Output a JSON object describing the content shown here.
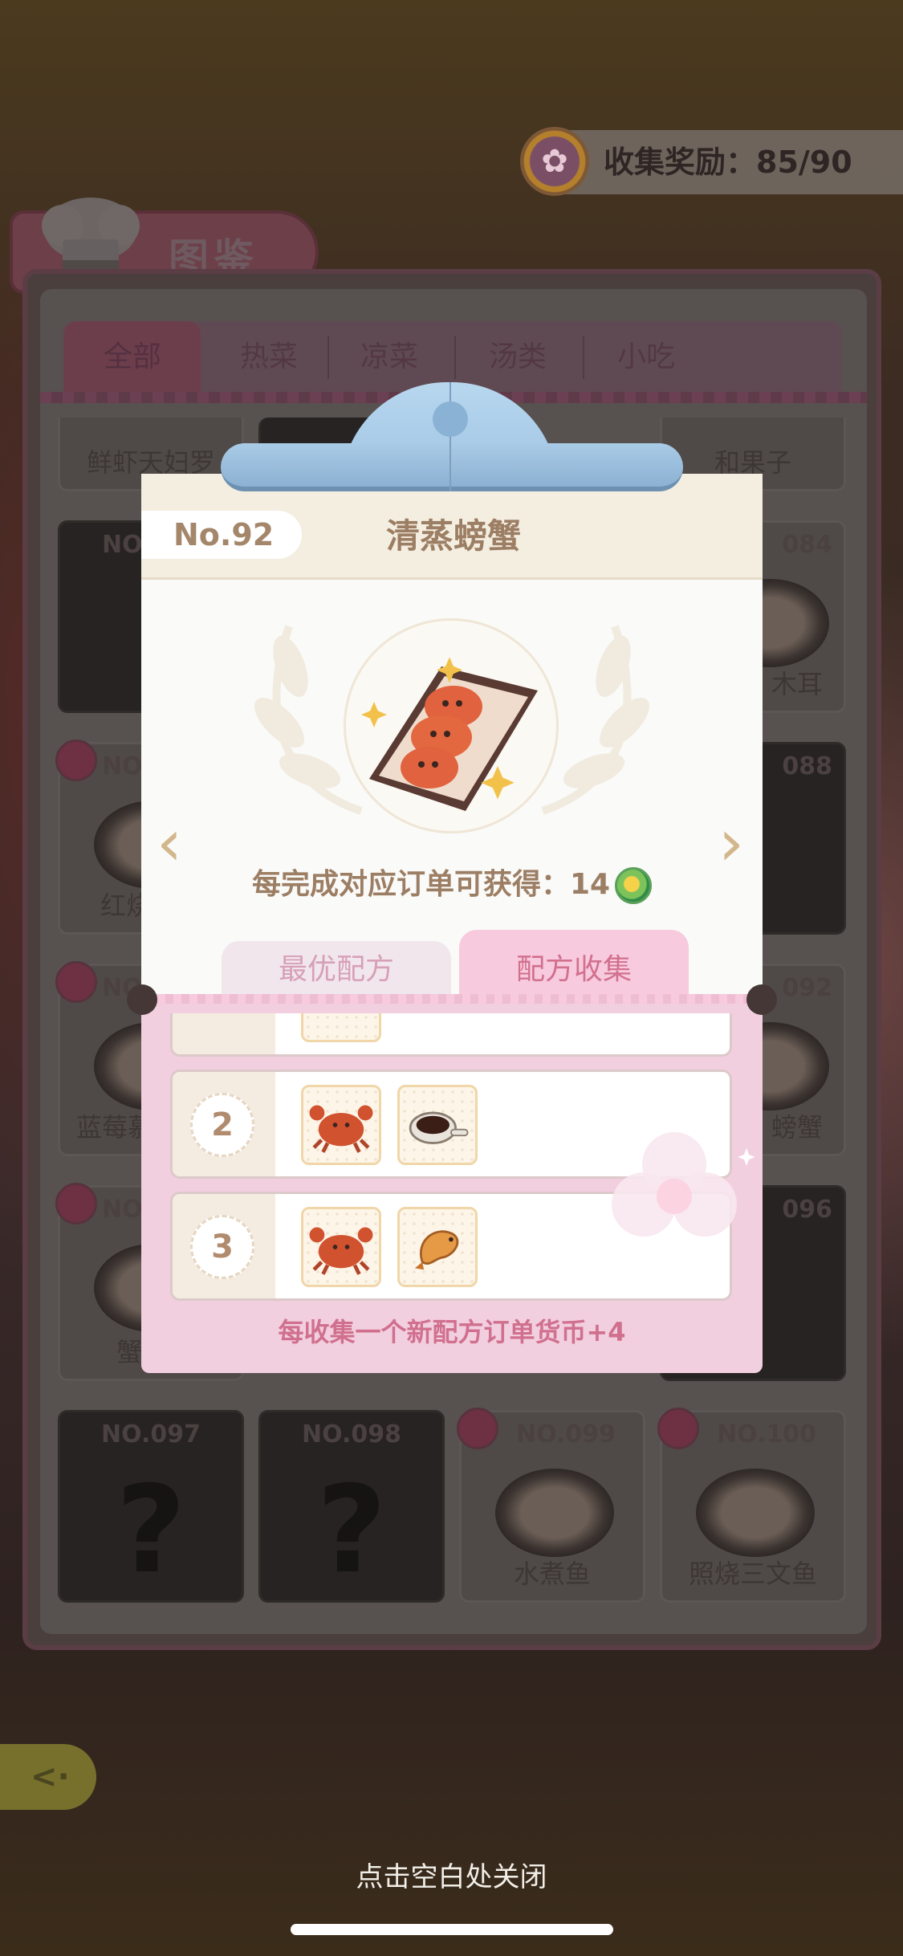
{
  "header": {
    "collect_reward_label": "收集奖励：85/90",
    "title": "图鉴"
  },
  "tabs": [
    "全部",
    "热菜",
    "凉菜",
    "汤类",
    "小吃"
  ],
  "background_grid": {
    "row1_names": [
      "鲜虾天妇罗",
      "和果子"
    ],
    "row2": [
      {
        "no": "NO.",
        "name": ""
      },
      {
        "no": "084",
        "name": "木耳"
      }
    ],
    "row3": [
      {
        "no": "NO.",
        "name": "红烧"
      },
      {
        "no": "088",
        "name": ""
      }
    ],
    "row4": [
      {
        "no": "NO.",
        "name": "蓝莓慕"
      },
      {
        "no": "092",
        "name": "螃蟹"
      }
    ],
    "row5": [
      {
        "no": "NO.",
        "name": "蟹"
      },
      {
        "no": "096",
        "name": ""
      }
    ],
    "row6": [
      {
        "no": "NO.097",
        "name": "",
        "locked": true
      },
      {
        "no": "NO.098",
        "name": "",
        "locked": true
      },
      {
        "no": "NO.099",
        "name": "水煮鱼",
        "locked": false
      },
      {
        "no": "NO.100",
        "name": "照烧三文鱼",
        "locked": false
      }
    ],
    "locked_symbol": "?"
  },
  "modal": {
    "number": "No.92",
    "dish_name": "清蒸螃蟹",
    "reward_text": "每完成对应订单可获得：14",
    "prev_arrow": "‹",
    "next_arrow": "›",
    "tab_best": "最优配方",
    "tab_collect": "配方收集",
    "recipes": [
      {
        "num": "2",
        "ingredients": [
          "crab-icon",
          "soy-sauce-icon"
        ]
      },
      {
        "num": "3",
        "ingredients": [
          "crab-icon",
          "shrimp-icon"
        ]
      }
    ],
    "footer_note": "每收集一个新配方订单货币+4"
  },
  "close_hint": "点击空白处关闭",
  "colors": {
    "accent_pink": "#d2708e",
    "clip_blue": "#9ec3e2",
    "header_brown": "#9c7e64"
  }
}
